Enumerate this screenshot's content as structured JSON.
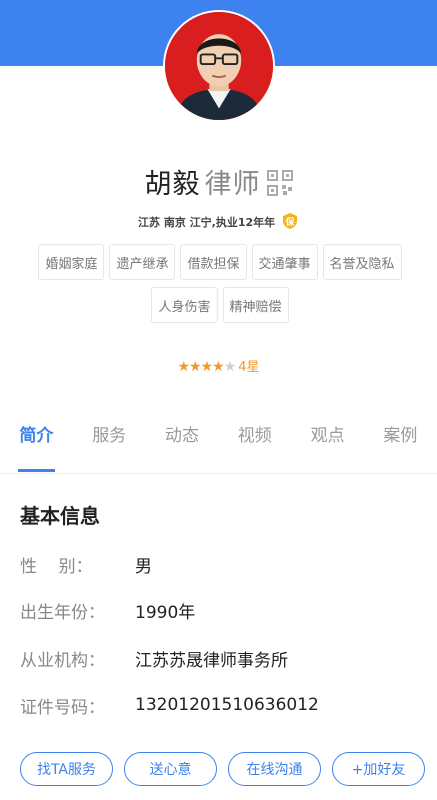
{
  "header": {
    "accent_color": "#3d82ee"
  },
  "profile": {
    "name": "胡毅",
    "title": "律师",
    "meta": "江苏 南京 江宁,执业12年年",
    "badge_text": "保",
    "tags": [
      "婚姻家庭",
      "遗产继承",
      "借款担保",
      "交通肇事",
      "名誉及隐私",
      "人身伤害",
      "精神赔偿"
    ],
    "rating": {
      "stars": 4,
      "max": 5,
      "label": "4星"
    }
  },
  "tabs": [
    {
      "label": "简介",
      "active": true
    },
    {
      "label": "服务",
      "active": false
    },
    {
      "label": "动态",
      "active": false
    },
    {
      "label": "视频",
      "active": false
    },
    {
      "label": "观点",
      "active": false
    },
    {
      "label": "案例",
      "active": false
    }
  ],
  "basic_info": {
    "title": "基本信息",
    "rows": [
      {
        "label": "性    别：",
        "value": "男"
      },
      {
        "label": "出生年份：",
        "value": "1990年"
      },
      {
        "label": "从业机构：",
        "value": "江苏苏晟律师事务所"
      },
      {
        "label": "证件号码：",
        "value": "13201201510636012"
      }
    ]
  },
  "actions": [
    "找TA服务",
    "送心意",
    "在线沟通",
    "+加好友"
  ]
}
